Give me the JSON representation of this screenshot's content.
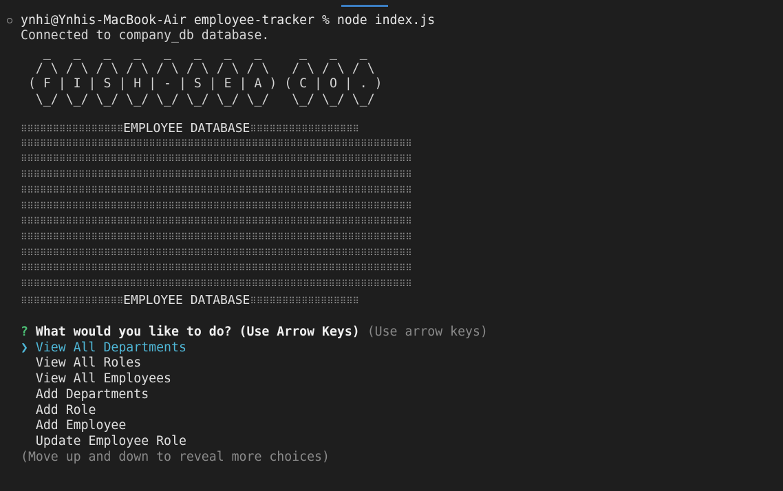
{
  "terminal": {
    "prompt": "ynhi@Ynhis-MacBook-Air employee-tracker % node index.js",
    "connected_message": "Connected to company_db database.",
    "logo_text": "FISH-SEA CO.",
    "logo_art": "   _   _   _   _   _   _   _   _     _   _   _\n  / \\ / \\ / \\ / \\ / \\ / \\ / \\ / \\   / \\ / \\ / \\\n ( F | I | S | H | - | S | E | A ) ( C | O | . )\n  \\_/ \\_/ \\_/ \\_/ \\_/ \\_/ \\_/ \\_/   \\_/ \\_/ \\_/",
    "banner_title": "EMPLOYEE DATABASE",
    "question_mark": "?",
    "question": "What would you like to do? (Use Arrow Keys)",
    "question_hint": "(Use arrow keys)",
    "pointer": "❯",
    "choices": [
      "View All Departments",
      "View All Roles",
      "View All Employees",
      "Add Departments",
      "Add Role",
      "Add Employee",
      "Update Employee Role"
    ],
    "selected_index": 0,
    "footer_hint": "(Move up and down to reveal more choices)"
  },
  "colors": {
    "background": "#1e1e1e",
    "selected": "#4fb8d8",
    "question_mark": "#4cbf75"
  }
}
